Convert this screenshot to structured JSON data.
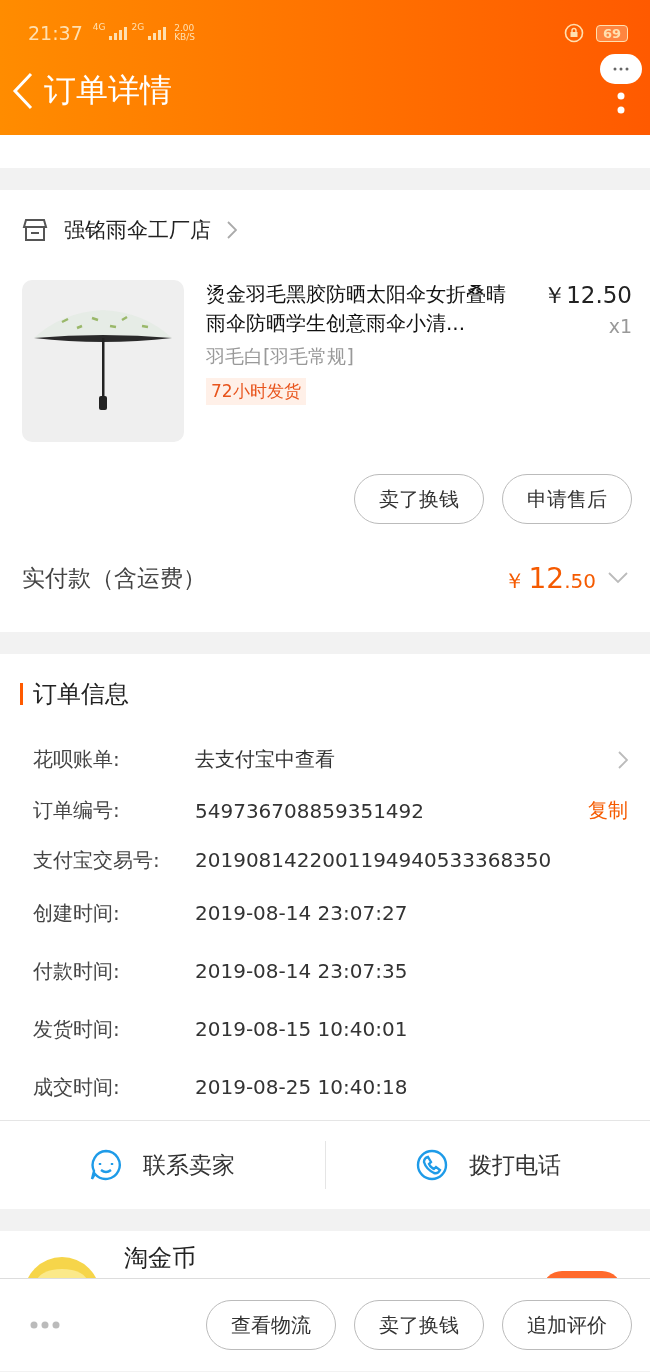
{
  "status_bar": {
    "time": "21:37",
    "network_1": "4G",
    "network_2": "2G",
    "speed": "2.00",
    "speed_unit": "KB/S",
    "battery": "69"
  },
  "header": {
    "title": "订单详情"
  },
  "shop": {
    "name": "强铭雨伞工厂店"
  },
  "item": {
    "title": "烫金羽毛黑胶防晒太阳伞女折叠晴雨伞防晒学生创意雨伞小清...",
    "price": "￥12.50",
    "quantity": "x1",
    "variant": "羽毛白[羽毛常规]",
    "tag": "72小时发货"
  },
  "item_actions": [
    "卖了换钱",
    "申请售后"
  ],
  "total": {
    "label": "实付款（含运费）",
    "currency": "￥",
    "amount": "12",
    "decimals": ".50"
  },
  "order_info": {
    "title": "订单信息",
    "rows": [
      {
        "kind": "link",
        "label": "花呗账单:",
        "value": "去支付宝中查看"
      },
      {
        "kind": "copy",
        "label": "订单编号:",
        "value": "549736708859351492",
        "action": "复制"
      },
      {
        "kind": "plain",
        "label": "支付宝交易号:",
        "value": "2019081422001194940533368350"
      },
      {
        "kind": "plain",
        "label": "创建时间:",
        "value": "2019-08-14 23:07:27"
      },
      {
        "kind": "plain",
        "label": "付款时间:",
        "value": "2019-08-14 23:07:35"
      },
      {
        "kind": "plain",
        "label": "发货时间:",
        "value": "2019-08-15 10:40:01"
      },
      {
        "kind": "plain",
        "label": "成交时间:",
        "value": "2019-08-25 10:40:18"
      }
    ]
  },
  "contact": [
    {
      "kind": "chat",
      "label": "联系卖家"
    },
    {
      "kind": "phone",
      "label": "拨打电话"
    }
  ],
  "peek": {
    "title": "淘金币"
  },
  "bottom_bar": {
    "buttons": [
      "查看物流",
      "卖了换钱",
      "追加评价"
    ]
  }
}
